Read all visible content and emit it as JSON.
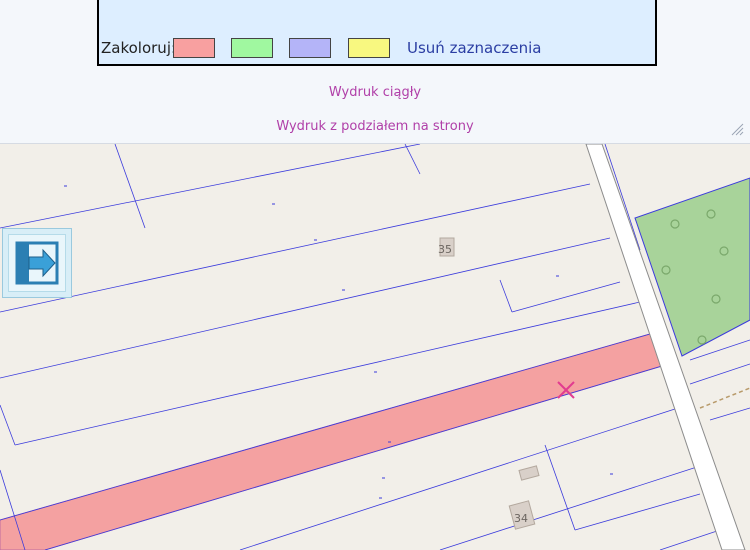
{
  "color_panel": {
    "label": "Zakoloruj:",
    "swatches": [
      {
        "name": "red",
        "color": "#f8a0a0"
      },
      {
        "name": "green",
        "color": "#a0f8a0"
      },
      {
        "name": "blue",
        "color": "#b4b4f8"
      },
      {
        "name": "yellow",
        "color": "#f8f880"
      }
    ],
    "clear_label": "Usuń zaznaczenia"
  },
  "print": {
    "continuous_label": "Wydruk ciągły",
    "paged_label": "Wydruk z podziałem na strony"
  },
  "map": {
    "building_numbers": [
      "35",
      "34"
    ],
    "highlight_color": "#f4a1a1",
    "forest_color": "#a8d39a",
    "parcel_line_color": "#3b3bdc"
  },
  "collapse_button": {
    "icon": "arrow-right-icon"
  }
}
